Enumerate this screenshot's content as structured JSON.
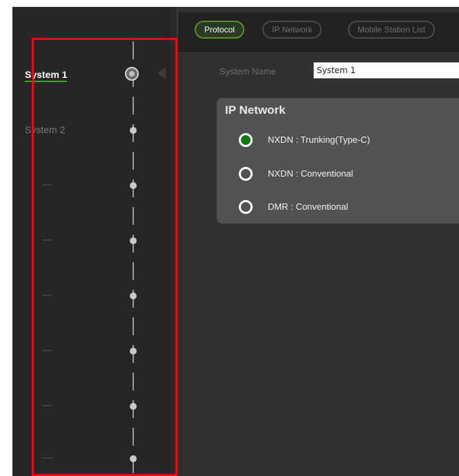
{
  "tabs": [
    {
      "label": "Protocol",
      "active": true
    },
    {
      "label": "IP Network",
      "active": false
    },
    {
      "label": "Mobile Station List",
      "active": false
    }
  ],
  "sidebar": {
    "items": [
      {
        "label": "System 1",
        "state": "active"
      },
      {
        "label": "System 2",
        "state": "normal"
      },
      {
        "label": "----",
        "state": "placeholder"
      },
      {
        "label": "----",
        "state": "placeholder"
      },
      {
        "label": "----",
        "state": "placeholder"
      },
      {
        "label": "----",
        "state": "placeholder"
      },
      {
        "label": "----",
        "state": "placeholder"
      },
      {
        "label": "----",
        "state": "placeholder"
      }
    ]
  },
  "system_name": {
    "label": "System Name",
    "value": "System 1"
  },
  "ip_network_group": {
    "title": "IP Network",
    "options": [
      {
        "label": "NXDN : Trunking(Type-C)",
        "checked": true
      },
      {
        "label": "NXDN : Conventional",
        "checked": false
      },
      {
        "label": "DMR : Conventional",
        "checked": false
      }
    ]
  },
  "colors": {
    "accent_green": "#5a8e2e",
    "radio_checked": "#0f7a12",
    "highlight_frame": "#e01010"
  }
}
